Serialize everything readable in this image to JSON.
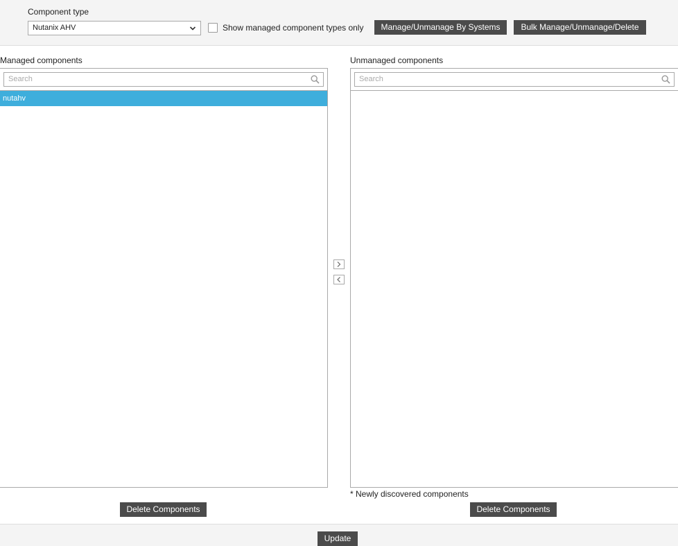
{
  "header": {
    "component_type_label": "Component type",
    "component_type_value": "Nutanix AHV",
    "show_managed_label": "Show managed component types only",
    "show_managed_checked": false,
    "manage_by_systems_label": "Manage/Unmanage By Systems",
    "bulk_label": "Bulk Manage/Unmanage/Delete"
  },
  "managed": {
    "title": "Managed components",
    "search_placeholder": "Search",
    "items": [
      {
        "label": "nutahv",
        "selected": true
      }
    ],
    "delete_label": "Delete Components"
  },
  "transfer": {
    "move_right_icon": "chevron-right-icon",
    "move_left_icon": "chevron-left-icon"
  },
  "unmanaged": {
    "title": "Unmanaged components",
    "search_placeholder": "Search",
    "items": [],
    "note": "* Newly discovered components",
    "delete_label": "Delete Components"
  },
  "footer": {
    "update_label": "Update"
  },
  "colors": {
    "button_bg": "#4b4b4b",
    "selected_item_bg": "#3eaedc",
    "toolbar_bg": "#f4f4f4"
  }
}
